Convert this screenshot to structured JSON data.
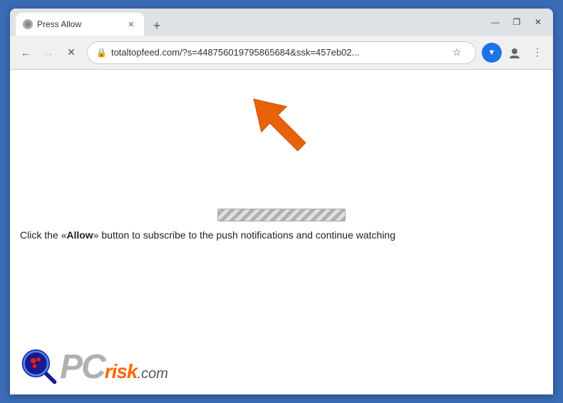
{
  "browser": {
    "window_controls": {
      "minimize": "—",
      "maximize": "❐",
      "close": "✕"
    },
    "tab": {
      "title": "Press Allow",
      "favicon_alt": "page icon"
    },
    "new_tab_btn": "+",
    "nav": {
      "back": "←",
      "forward": "→",
      "stop": "✕",
      "url": "totaltopfeed.com/?s=448756019795865684&ssk=457eb02...",
      "url_full": "totaltopfeed.com/?s=448756019795865684&ssk=457eb02..."
    },
    "ext_icon_label": "▼"
  },
  "page": {
    "message": "Click the «Allow» button to subscribe to the push notifications and continue watching",
    "allow_word": "Allow",
    "logo": {
      "pc": "PC",
      "risk": "risk",
      "dotcom": ".com"
    }
  }
}
